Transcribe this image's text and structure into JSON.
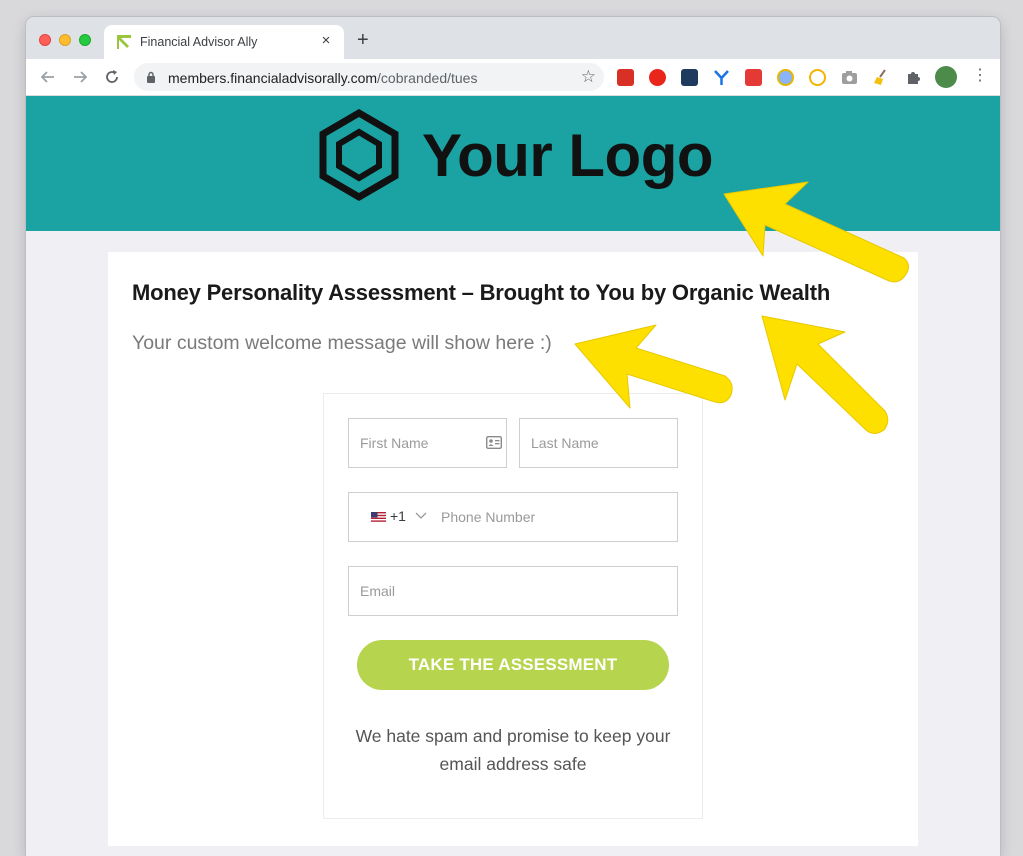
{
  "browser": {
    "tab_title": "Financial Advisor Ally",
    "close_glyph": "×",
    "new_tab_glyph": "+",
    "url_host": "members.financialadvisorally.com",
    "url_path": "/cobranded/tues",
    "star_glyph": "☆",
    "menu_glyph": "⋮"
  },
  "banner": {
    "logo_text": "Your Logo",
    "background": "#1ba3a3"
  },
  "content": {
    "headline": "Money Personality Assessment – Brought to You by Organic Wealth",
    "welcome": "Your custom welcome message will show here :)"
  },
  "form": {
    "first_name_placeholder": "First Name",
    "last_name_placeholder": "Last Name",
    "country_code": "+1",
    "phone_placeholder": "Phone Number",
    "email_placeholder": "Email",
    "submit_label": "TAKE THE ASSESSMENT",
    "submit_color": "#b7d44e",
    "spam_note_line1": "We hate spam and promise to keep your",
    "spam_note_line2": "email address safe"
  },
  "annotations": {
    "arrow_color": "#fde000"
  }
}
